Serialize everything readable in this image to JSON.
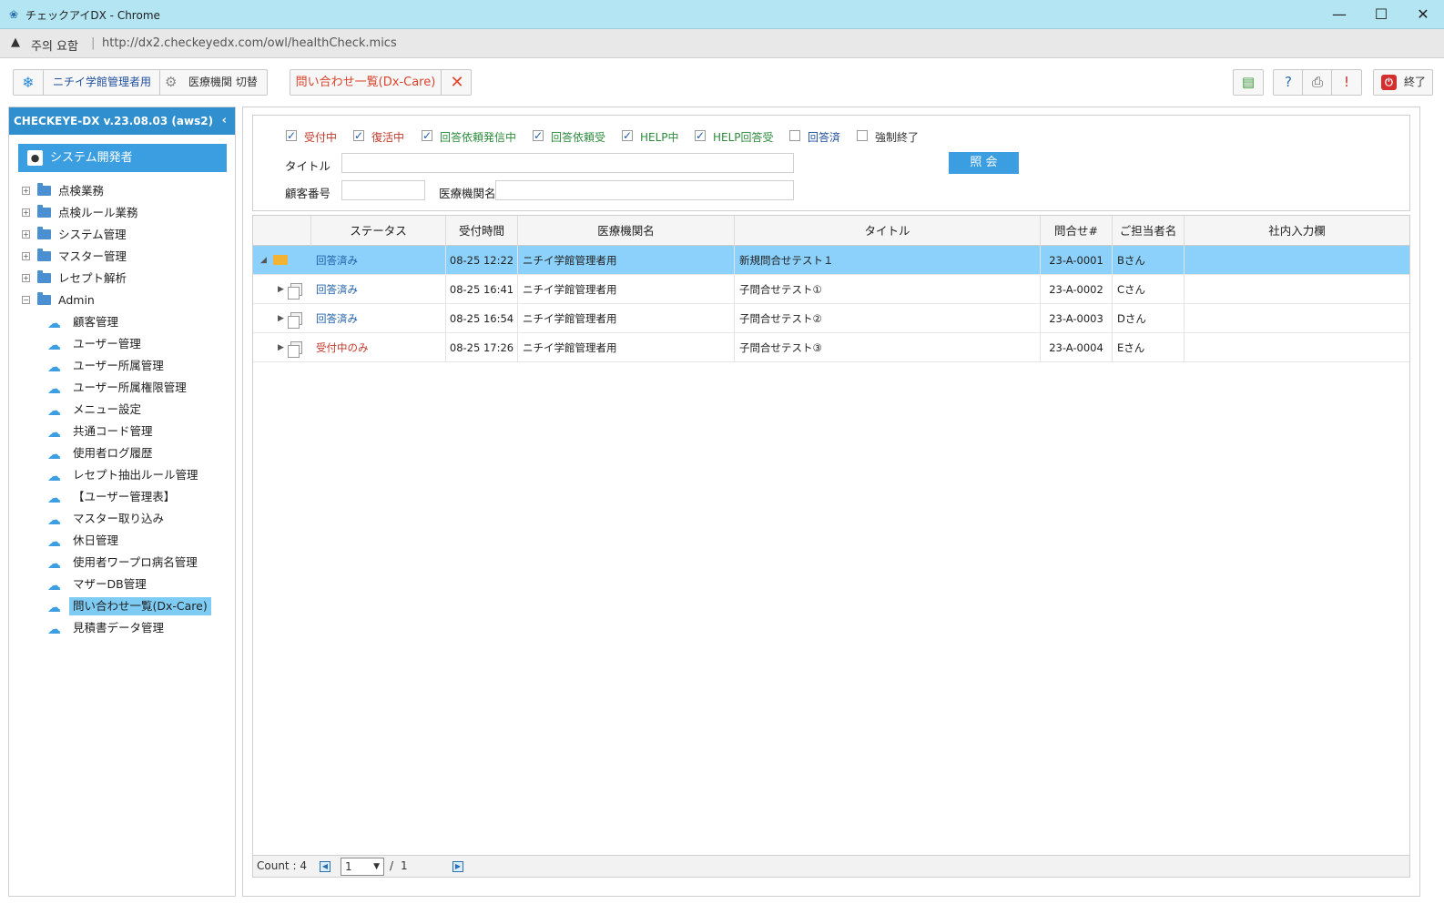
{
  "window": {
    "title": "チェックアイDX - Chrome",
    "min_glyph": "—",
    "max_glyph": "☐",
    "close_glyph": "✕"
  },
  "address": {
    "warning": "주의 요함",
    "separator": "|",
    "url": "http://dx2.checkeyedx.com/owl/healthCheck.mics"
  },
  "toolbar": {
    "org_label": "ニチイ学館管理者用",
    "switch_label": "医療機関 切替",
    "active_tab": "問い合わせ一覧(Dx-Care)",
    "close_tab_glyph": "✕",
    "exit_label": "終了",
    "icons": [
      "layout-icon",
      "help-icon",
      "print-icon",
      "alert-icon",
      "power-icon"
    ]
  },
  "sidebar": {
    "title": "CHECKEYE-DX v.23.08.03 (aws2)",
    "collapse_glyph": "‹",
    "user": "システム開発者",
    "folders": [
      {
        "label": "点検業務",
        "expanded": false
      },
      {
        "label": "点検ルール業務",
        "expanded": false
      },
      {
        "label": "システム管理",
        "expanded": false
      },
      {
        "label": "マスター管理",
        "expanded": false
      },
      {
        "label": "レセプト解析",
        "expanded": false
      },
      {
        "label": "Admin",
        "expanded": true
      }
    ],
    "admin_items": [
      "顧客管理",
      "ユーザー管理",
      "ユーザー所属管理",
      "ユーザー所属権限管理",
      "メニュー設定",
      "共通コード管理",
      "使用者ログ履歴",
      "レセプト抽出ルール管理",
      "【ユーザー管理表】",
      "マスター取り込み",
      "休日管理",
      "使用者ワープロ病名管理",
      "マザーDB管理",
      "問い合わせ一覧(Dx-Care)",
      "見積書データ管理"
    ],
    "selected_item": "問い合わせ一覧(Dx-Care)"
  },
  "filter": {
    "checkboxes": [
      {
        "label": "受付中",
        "checked": true,
        "color": "#c0392b"
      },
      {
        "label": "復活中",
        "checked": true,
        "color": "#c0392b"
      },
      {
        "label": "回答依頼発信中",
        "checked": true,
        "color": "#2e8b3e"
      },
      {
        "label": "回答依頼受",
        "checked": true,
        "color": "#2e8b3e"
      },
      {
        "label": "HELP中",
        "checked": true,
        "color": "#2e8b3e"
      },
      {
        "label": "HELP回答受",
        "checked": true,
        "color": "#2e8b3e"
      },
      {
        "label": "回答済",
        "checked": false,
        "color": "#1f4f9e"
      },
      {
        "label": "強制終了",
        "checked": false,
        "color": "#333333"
      }
    ],
    "title_label": "タイトル",
    "title_value": "",
    "customer_label": "顧客番号",
    "customer_value": "",
    "institution_label": "医療機関名",
    "institution_value": "",
    "search_button": "照 会"
  },
  "grid": {
    "columns": [
      "",
      "ステータス",
      "受付時間",
      "医療機関名",
      "タイトル",
      "問合せ#",
      "ご担当者名",
      "社内入力欄"
    ],
    "rows": [
      {
        "status": "回答済み",
        "status_color": "blue",
        "time": "08-25 12:22",
        "institution": "ニチイ学館管理者用",
        "title": "新規問合せテスト１",
        "id": "23-A-0001",
        "person": "Bさん",
        "note": "",
        "selected": true,
        "type": "parent"
      },
      {
        "status": "回答済み",
        "status_color": "blue",
        "time": "08-25 16:41",
        "institution": "ニチイ学館管理者用",
        "title": "子問合せテスト①",
        "id": "23-A-0002",
        "person": "Cさん",
        "note": "",
        "selected": false,
        "type": "child"
      },
      {
        "status": "回答済み",
        "status_color": "blue",
        "time": "08-25 16:54",
        "institution": "ニチイ学館管理者用",
        "title": "子問合せテスト②",
        "id": "23-A-0003",
        "person": "Dさん",
        "note": "",
        "selected": false,
        "type": "child"
      },
      {
        "status": "受付中のみ",
        "status_color": "red",
        "time": "08-25 17:26",
        "institution": "ニチイ学館管理者用",
        "title": "子問合せテスト③",
        "id": "23-A-0004",
        "person": "Eさん",
        "note": "",
        "selected": false,
        "type": "child"
      }
    ]
  },
  "pager": {
    "count_label": "Count :",
    "count_value": "4",
    "page": "1",
    "slash": "/",
    "total_pages": "1"
  }
}
